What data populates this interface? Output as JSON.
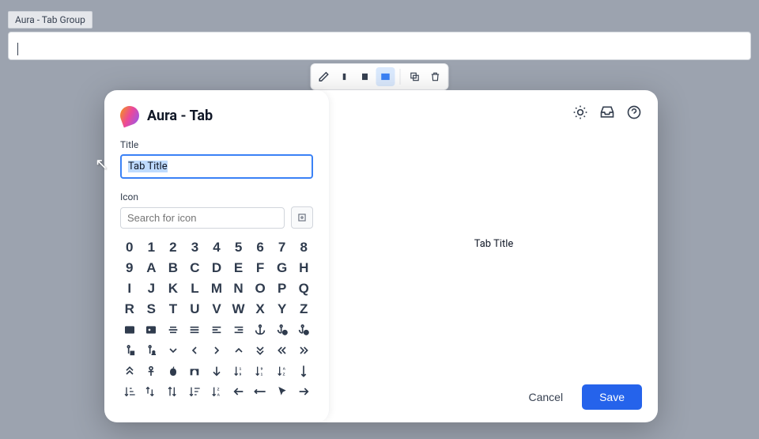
{
  "background": {
    "tab_group_label": "Aura - Tab Group"
  },
  "modal": {
    "title": "Aura - Tab",
    "fields": {
      "title_label": "Title",
      "title_value": "Tab Title",
      "icon_label": "Icon",
      "icon_search_placeholder": "Search for icon"
    },
    "icon_grid": [
      "0",
      "1",
      "2",
      "3",
      "4",
      "5",
      "6",
      "7",
      "8",
      "9",
      "A",
      "B",
      "C",
      "D",
      "E",
      "F",
      "G",
      "H",
      "I",
      "J",
      "K",
      "L",
      "M",
      "N",
      "O",
      "P",
      "Q",
      "R",
      "S",
      "T",
      "U",
      "V",
      "W",
      "X",
      "Y",
      "Z"
    ],
    "preview": {
      "tab_title": "Tab Title"
    },
    "footer": {
      "cancel": "Cancel",
      "save": "Save"
    }
  },
  "toolbar_icons": [
    "edit",
    "layout-narrow",
    "layout-medium",
    "layout-full",
    "copy",
    "delete"
  ]
}
